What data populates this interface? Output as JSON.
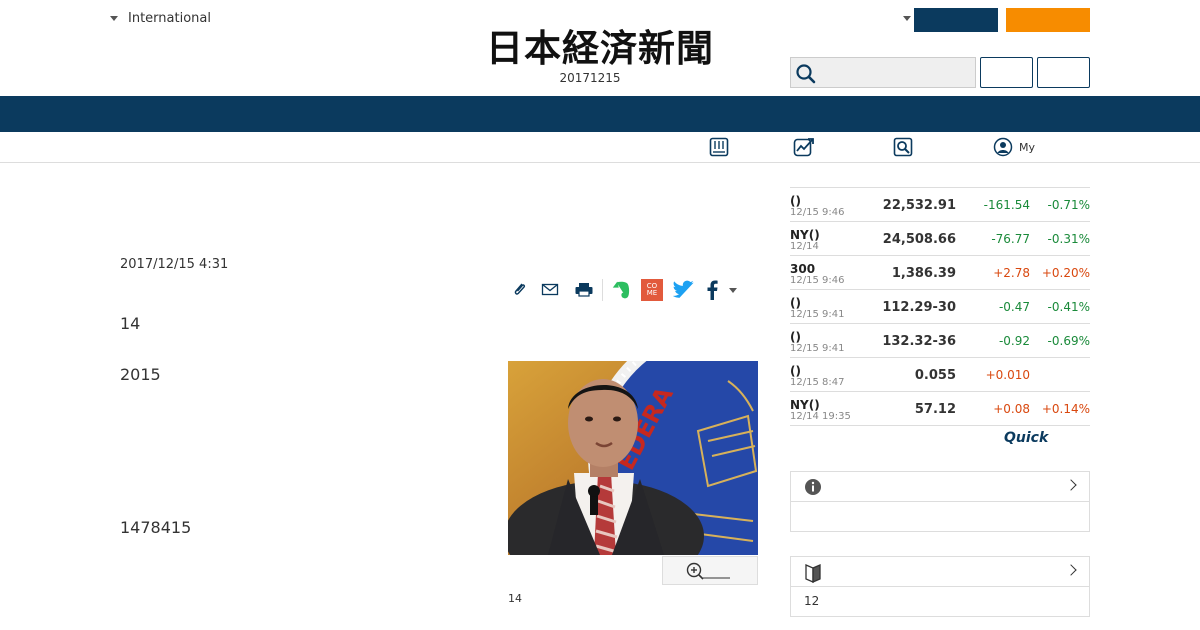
{
  "header": {
    "edition_label": "International",
    "logo_text": "日本経済新聞",
    "issue_date": "20171215"
  },
  "subnav": {
    "my_label": "My"
  },
  "article": {
    "published": "2017/12/15 4:31",
    "paragraph_1": "14",
    "paragraph_2": "2015",
    "paragraph_3": "1478415",
    "photo_caption": "14"
  },
  "market": {
    "rows": [
      {
        "name": "()",
        "time": "12/15 9:46",
        "value": "22,532.91",
        "change": "-161.54",
        "percent": "-0.71%",
        "dir": "neg"
      },
      {
        "name": "NY()",
        "time": "12/14",
        "value": "24,508.66",
        "change": "-76.77",
        "percent": "-0.31%",
        "dir": "neg"
      },
      {
        "name": "300",
        "time": "12/15 9:46",
        "value": "1,386.39",
        "change": "+2.78",
        "percent": "+0.20%",
        "dir": "pos"
      },
      {
        "name": "()",
        "time": "12/15 9:41",
        "value": "112.29-30",
        "change": "-0.47",
        "percent": "-0.41%",
        "dir": "neg"
      },
      {
        "name": "()",
        "time": "12/15 9:41",
        "value": "132.32-36",
        "change": "-0.92",
        "percent": "-0.69%",
        "dir": "neg"
      },
      {
        "name": "()",
        "time": "12/15 8:47",
        "value": "0.055",
        "change": "+0.010",
        "percent": "",
        "dir": "pos"
      },
      {
        "name": "NY()",
        "time": "12/14 19:35",
        "value": "57.12",
        "change": "+0.08",
        "percent": "+0.14%",
        "dir": "pos"
      }
    ],
    "provider": "Quick"
  },
  "sidebar": {
    "box2_text": "12"
  },
  "colors": {
    "navy": "#0b3a5e",
    "orange": "#f78c00",
    "negative": "#1a8a3a",
    "positive": "#d9480f"
  }
}
